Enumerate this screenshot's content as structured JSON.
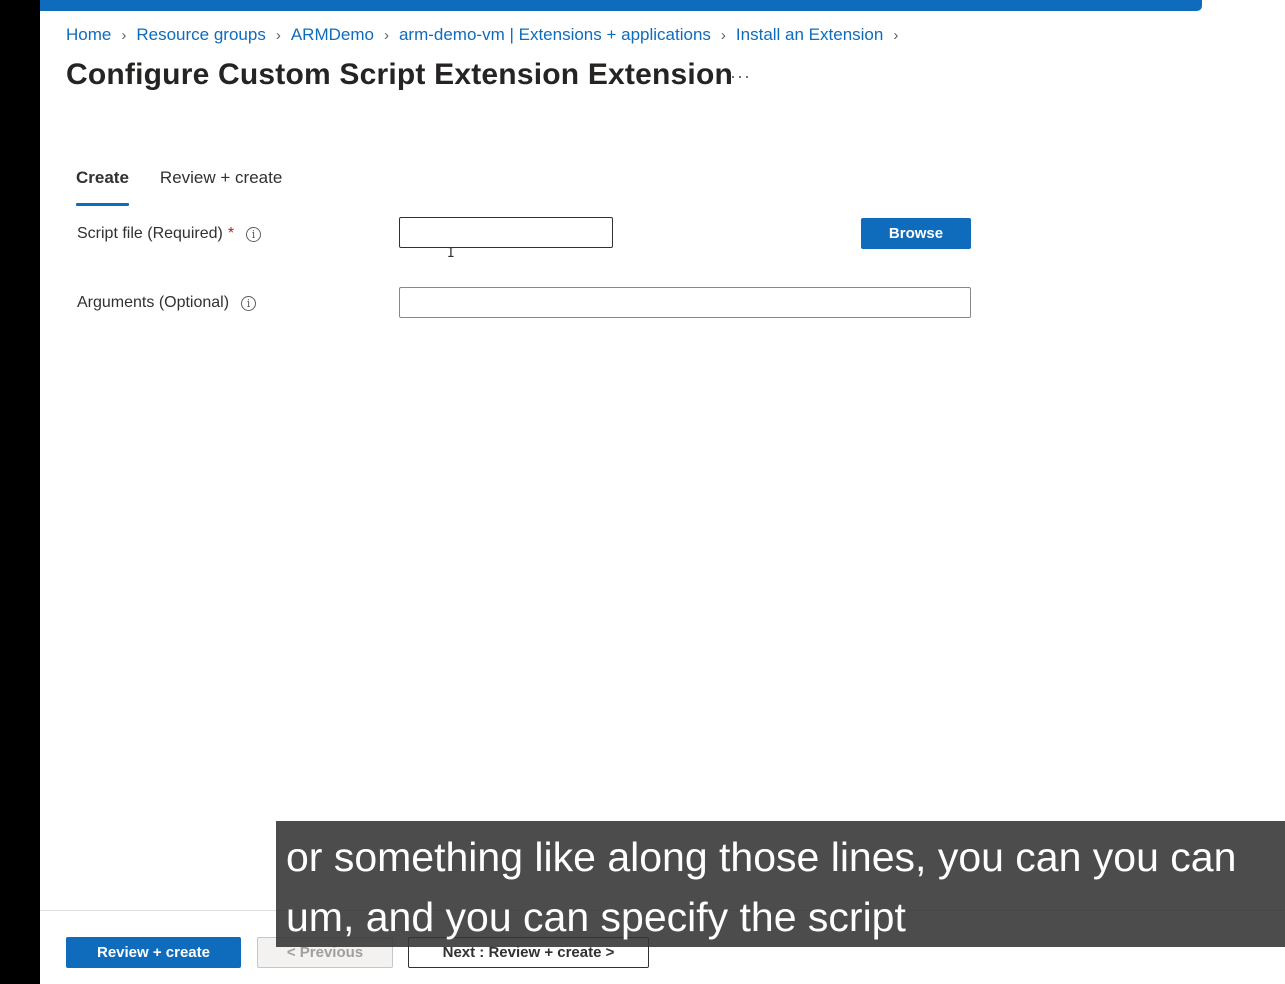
{
  "breadcrumb": [
    {
      "label": "Home"
    },
    {
      "label": "Resource groups"
    },
    {
      "label": "ARMDemo"
    },
    {
      "label": "arm-demo-vm | Extensions + applications"
    },
    {
      "label": "Install an Extension"
    }
  ],
  "page": {
    "title": "Configure Custom Script Extension Extension",
    "more_label": "···"
  },
  "tabs": [
    {
      "label": "Create",
      "active": true
    },
    {
      "label": "Review + create",
      "active": false
    }
  ],
  "form": {
    "script_file": {
      "label": "Script file (Required)",
      "required_mark": "*",
      "value": "",
      "info_glyph": "i"
    },
    "browse_label": "Browse",
    "arguments": {
      "label": "Arguments (Optional)",
      "value": "",
      "info_glyph": "i"
    }
  },
  "footer": {
    "review_create_label": "Review + create",
    "previous_label": "< Previous",
    "next_label": "Next : Review + create >"
  },
  "caption": {
    "line1": "or something like along those lines, you can you can",
    "line2": "um, and you can specify the script"
  },
  "icons": {
    "breadcrumb_separator": "chevron-right-icon",
    "info": "info-icon",
    "more": "more-icon"
  },
  "colors": {
    "accent": "#0f6cbd",
    "required": "#a4262c",
    "caption_bg": "#333333"
  }
}
